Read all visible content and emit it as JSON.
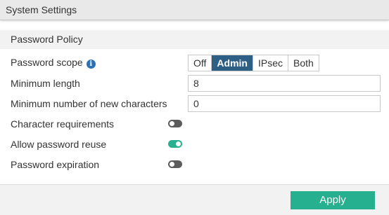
{
  "window": {
    "title": "System Settings"
  },
  "section": {
    "title": "Password Policy"
  },
  "password_scope": {
    "label": "Password scope",
    "info_icon": "info-circle-icon",
    "options": [
      "Off",
      "Admin",
      "IPsec",
      "Both"
    ],
    "selected": "Admin"
  },
  "minimum_length": {
    "label": "Minimum length",
    "value": "8"
  },
  "minimum_new_chars": {
    "label": "Minimum number of new characters",
    "value": "0"
  },
  "character_requirements": {
    "label": "Character requirements",
    "enabled": false
  },
  "allow_password_reuse": {
    "label": "Allow password reuse",
    "enabled": true
  },
  "password_expiration": {
    "label": "Password expiration",
    "enabled": false
  },
  "footer": {
    "apply_label": "Apply"
  },
  "colors": {
    "accent_green": "#26b08f",
    "segment_active": "#2e5f84",
    "toggle_off": "#5c5c5c",
    "info_icon": "#2b72b5"
  }
}
